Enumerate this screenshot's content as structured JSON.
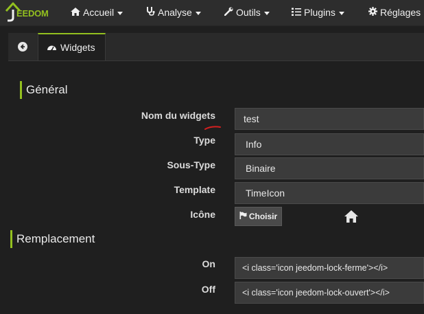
{
  "navbar": {
    "brand": "EEDOM",
    "items": [
      {
        "label": "Accueil",
        "icon": "home-icon"
      },
      {
        "label": "Analyse",
        "icon": "stethoscope-icon"
      },
      {
        "label": "Outils",
        "icon": "wrench-icon"
      },
      {
        "label": "Plugins",
        "icon": "tasks-icon"
      },
      {
        "label": "Réglages",
        "icon": "cog-icon"
      }
    ]
  },
  "tabs": {
    "active_label": "Widgets",
    "active_icon": "dashboard-icon",
    "back_icon": "arrow-circle-left-icon"
  },
  "sections": {
    "general": "Général",
    "replacement": "Remplacement"
  },
  "form": {
    "name_label": "Nom du widgets",
    "name_value": "test",
    "type_label": "Type",
    "type_value": "Info",
    "subtype_label": "Sous-Type",
    "subtype_value": "Binaire",
    "template_label": "Template",
    "template_value": "TimeIcon",
    "icon_label": "Icône",
    "choose_button": "Choisir",
    "selected_icon": "home-icon"
  },
  "replacement": {
    "on_label": "On",
    "on_value": "<i class='icon jeedom-lock-ferme'></i>",
    "off_label": "Off",
    "off_value": "<i class='icon jeedom-lock-ouvert'></i>"
  },
  "colors": {
    "accent": "#93c01f",
    "background": "#1f1f1f",
    "navbar": "#2d2d2d",
    "field": "#3b3b3b"
  }
}
